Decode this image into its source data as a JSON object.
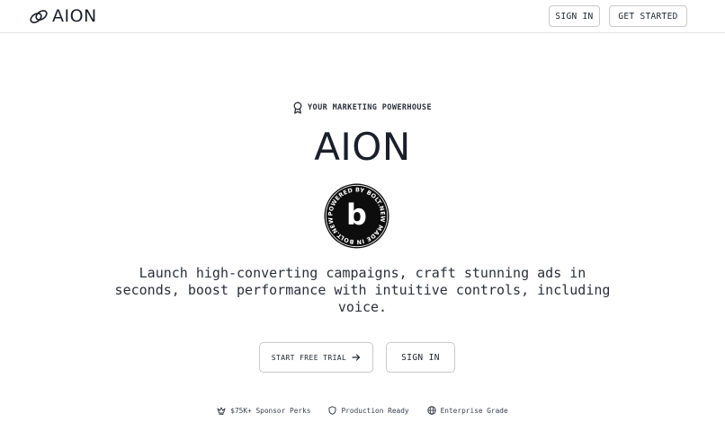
{
  "header": {
    "logo_text": "AION",
    "signin_label": "SIGN IN",
    "get_started_label": "GET STARTED"
  },
  "hero": {
    "tagline": "YOUR MARKETING POWERHOUSE",
    "title": "AION",
    "badge": {
      "ring_text": "POWERED BY BOLT.NEW MADE IN BOLT.NEW",
      "center_letter": "b"
    },
    "description": "Launch high-converting campaigns, craft stunning ads in seconds, boost performance with intuitive controls, including voice."
  },
  "cta": {
    "trial_label": "START FREE TRIAL",
    "trial_icon": "arrow-right-icon",
    "signin_label": "SIGN IN"
  },
  "features": [
    {
      "icon": "crown-icon",
      "label": "$75K+ Sponsor Perks"
    },
    {
      "icon": "shield-icon",
      "label": "Production Ready"
    },
    {
      "icon": "globe-icon",
      "label": "Enterprise Grade"
    }
  ],
  "colors": {
    "text": "#1b1f2a",
    "border": "#c9c9ce",
    "badge_bg": "#0d0d0d",
    "badge_fg": "#ffffff"
  }
}
